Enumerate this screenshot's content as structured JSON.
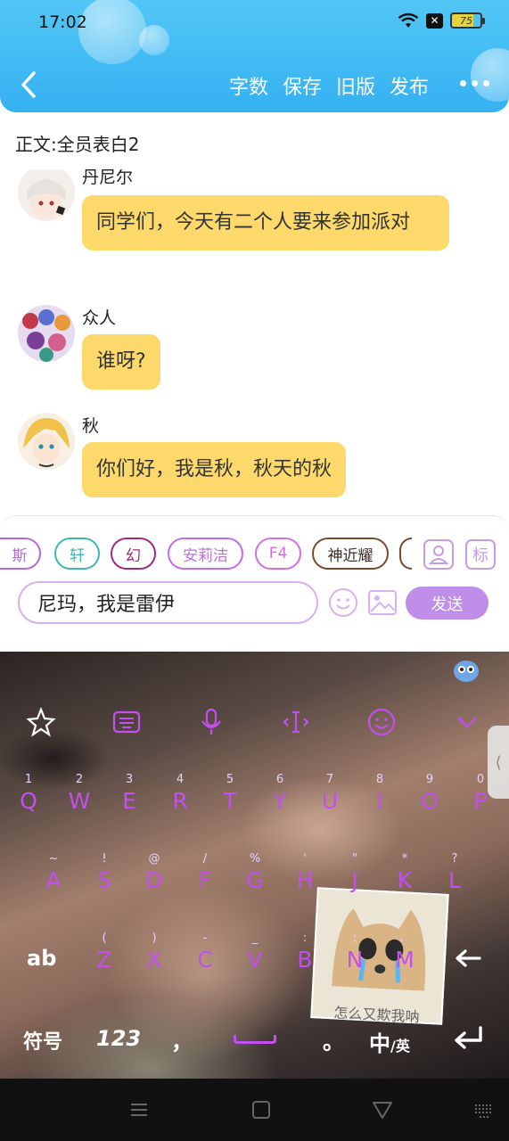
{
  "status": {
    "time": "17:02",
    "battery": "75"
  },
  "header": {
    "actions": [
      "字数",
      "保存",
      "旧版",
      "发布"
    ]
  },
  "title": "正文:全员表白2",
  "messages": [
    {
      "name": "丹尼尔",
      "text": "同学们，今天有二个人要来参加派对"
    },
    {
      "name": "众人",
      "text": "谁呀?"
    },
    {
      "name": "秋",
      "text": "你们好，我是秋，秋天的秋"
    }
  ],
  "chips": [
    "斯",
    "轩",
    "幻",
    "安莉洁",
    "F4",
    "神近耀"
  ],
  "chip_colors": [
    "#b36ae0",
    "#3fb6b0",
    "#a0297a",
    "#c26be6",
    "#d070e0",
    "#7a4a2e"
  ],
  "side_buttons": [
    "标"
  ],
  "composer": {
    "input_value": "尼玛，我是雷伊",
    "send_label": "发送"
  },
  "keyboard": {
    "row1": [
      {
        "k": "Q",
        "s": "1"
      },
      {
        "k": "W",
        "s": "2"
      },
      {
        "k": "E",
        "s": "3"
      },
      {
        "k": "R",
        "s": "4"
      },
      {
        "k": "T",
        "s": "5"
      },
      {
        "k": "Y",
        "s": "6"
      },
      {
        "k": "U",
        "s": "7"
      },
      {
        "k": "I",
        "s": "8"
      },
      {
        "k": "O",
        "s": "9"
      },
      {
        "k": "P",
        "s": "0"
      }
    ],
    "row2": [
      {
        "k": "A",
        "s": "~"
      },
      {
        "k": "S",
        "s": "!"
      },
      {
        "k": "D",
        "s": "@"
      },
      {
        "k": "F",
        "s": "/"
      },
      {
        "k": "G",
        "s": "%"
      },
      {
        "k": "H",
        "s": "'"
      },
      {
        "k": "J",
        "s": "\""
      },
      {
        "k": "K",
        "s": "*"
      },
      {
        "k": "L",
        "s": "?"
      }
    ],
    "row3": [
      {
        "k": "Z",
        "s": "("
      },
      {
        "k": "X",
        "s": ")"
      },
      {
        "k": "C",
        "s": "-"
      },
      {
        "k": "V",
        "s": "_"
      },
      {
        "k": "B",
        "s": ":"
      },
      {
        "k": "N",
        "s": ";"
      },
      {
        "k": "M",
        "s": "、"
      }
    ],
    "shift_label": "ab",
    "symbol_label": "符号",
    "num_label": "123",
    "comma_label": "，",
    "period_label": "。",
    "lang_label_main": "中",
    "lang_label_sub": "/英",
    "sticker_caption": "怎么又欺我呐"
  },
  "colors": {
    "header": "#3fb9f4",
    "bubble": "#fcd96a",
    "send": "#bf8ee8",
    "key_text": "#c34ff0"
  }
}
